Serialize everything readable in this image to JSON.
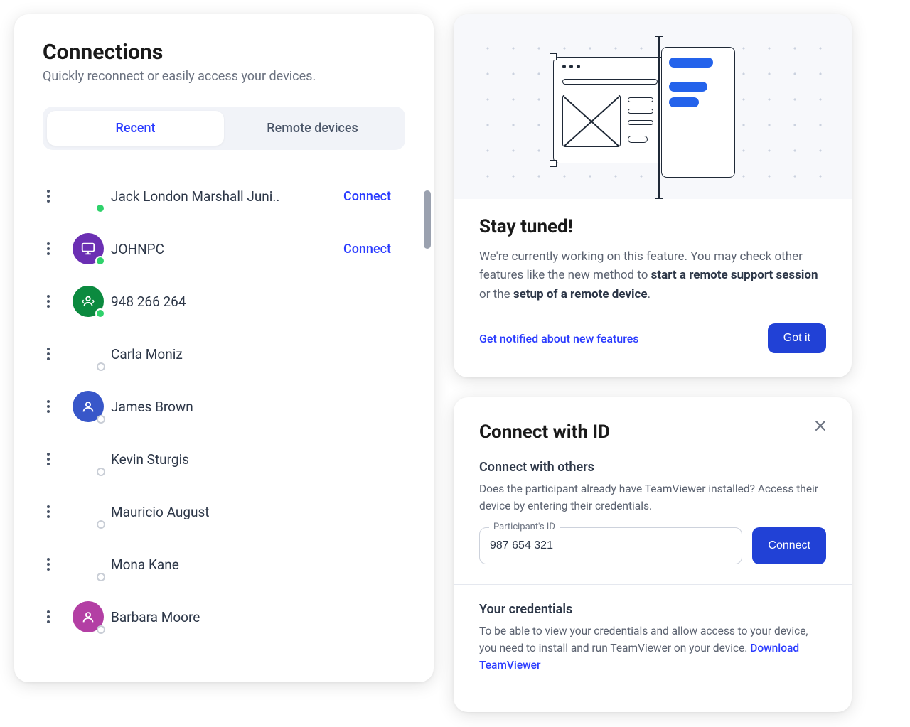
{
  "connections": {
    "title": "Connections",
    "subtitle": "Quickly reconnect or easily access your devices.",
    "tabs": {
      "recent": "Recent",
      "remote": "Remote devices"
    },
    "connect_label": "Connect",
    "items": [
      {
        "name": "Jack London Marshall Juni..",
        "avatar": "none",
        "status": "online",
        "connect": true
      },
      {
        "name": "JOHNPC",
        "avatar": "monitor",
        "status": "online",
        "connect": true,
        "color": "purple"
      },
      {
        "name": "948 266 264",
        "avatar": "swap",
        "status": "online",
        "connect": false,
        "color": "green"
      },
      {
        "name": "Carla Moniz",
        "avatar": "none",
        "status": "offline",
        "connect": false
      },
      {
        "name": "James Brown",
        "avatar": "person",
        "status": "offline",
        "connect": false,
        "color": "blue"
      },
      {
        "name": "Kevin Sturgis",
        "avatar": "none",
        "status": "offline",
        "connect": false
      },
      {
        "name": "Mauricio August",
        "avatar": "none",
        "status": "offline",
        "connect": false
      },
      {
        "name": "Mona Kane",
        "avatar": "none",
        "status": "offline",
        "connect": false
      },
      {
        "name": "Barbara Moore",
        "avatar": "person",
        "status": "offline",
        "connect": false,
        "color": "magenta"
      }
    ]
  },
  "stay_tuned": {
    "title": "Stay tuned!",
    "body_pre": "We're currently working on this feature. You may check other features like the new method to ",
    "bold1": "start a remote support session",
    "mid": " or the ",
    "bold2": "setup of a remote device",
    "post": ".",
    "notify_link": "Get notified about new features",
    "gotit": "Got it"
  },
  "connect_id": {
    "title": "Connect with ID",
    "section1_title": "Connect with others",
    "section1_text": "Does the participant already have TeamViewer installed? Access their device by entering their credentials.",
    "input_label": "Participant's ID",
    "input_value": "987 654 321",
    "connect_btn": "Connect",
    "section2_title": "Your credentials",
    "section2_text": "To be able to view your credentials and allow access to your device, you need to install and run TeamViewer on your device.  ",
    "download_link": "Download TeamViewer"
  }
}
